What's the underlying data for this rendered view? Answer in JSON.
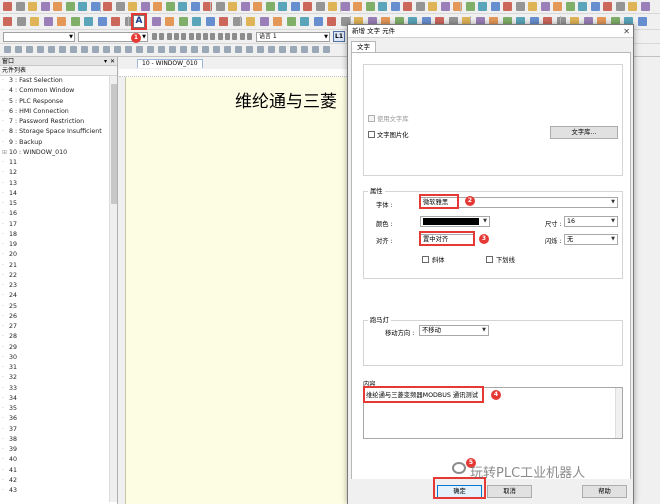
{
  "font_selector": {
    "value": ""
  },
  "language_selector": {
    "value": "语言 1"
  },
  "l1_button": {
    "label": "L1"
  },
  "badges": {
    "b1": "1",
    "b2": "2",
    "b3": "3",
    "b4": "4",
    "b5": "5"
  },
  "window_panel": {
    "header": "窗口",
    "subheader": "元件列表",
    "items": [
      "3 : Fast Selection",
      "4 : Common Window",
      "5 : PLC Response",
      "6 : HMI Connection",
      "7 : Password Restriction",
      "8 : Storage Space Insufficient",
      "9 : Backup",
      "10 : WINDOW_010",
      "11",
      "12",
      "13",
      "14",
      "15",
      "16",
      "17",
      "18",
      "19",
      "20",
      "21",
      "22",
      "23",
      "24",
      "25",
      "26",
      "27",
      "28",
      "29",
      "30",
      "31",
      "32",
      "33",
      "34",
      "35",
      "36",
      "37",
      "38",
      "39",
      "40",
      "41",
      "42",
      "43"
    ]
  },
  "editor": {
    "tab_label": "10 - WINDOW_010",
    "canvas_text": "维纶通与三菱"
  },
  "dialog": {
    "title": "新增 文字 元件",
    "tab": "文字",
    "use_text_library": "使用文字库",
    "text_graphic": "文字图片化",
    "text_library_button": "文字库...",
    "attributes_group": "属性",
    "font_label": "字体 :",
    "font_value": "微软雅黑",
    "color_label": "颜色 :",
    "size_label": "尺寸 :",
    "size_value": "16",
    "align_label": "对齐 :",
    "align_value": "置中对齐",
    "blink_label": "闪烁 :",
    "blink_value": "无",
    "italic_label": "斜体",
    "underline_label": "下划线",
    "marquee_group": "跑马灯",
    "move_dir_label": "移动方向 :",
    "move_dir_value": "不移动",
    "content_group": "内容",
    "content_text": "维纶通与三菱变频器MODBUS 通讯测试",
    "ok_button": "确定",
    "cancel_button": "取消",
    "help_button": "帮助"
  },
  "watermark": "玩转PLC工业机器人",
  "colors": {
    "highlight": "#e53935",
    "canvas": "#fdfde3",
    "text_color_swatch": "#000000"
  }
}
